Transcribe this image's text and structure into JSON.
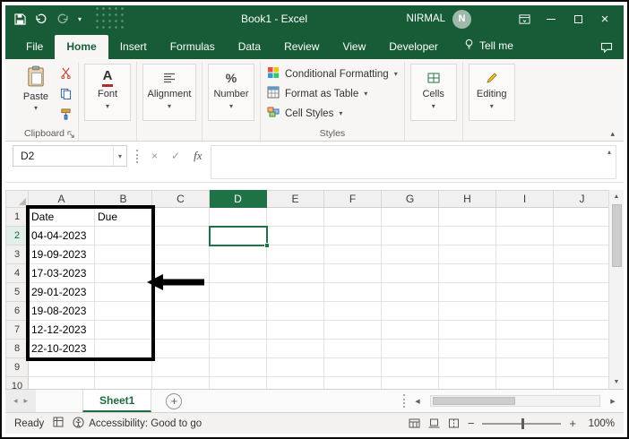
{
  "glyphs": {
    "chevron_down": "▾",
    "chevron_up": "▴",
    "close": "×",
    "cancel": "×",
    "check": "✓",
    "scroll_up": "▲",
    "scroll_down": "▼",
    "scroll_left": "◀",
    "scroll_right": "▶",
    "nav_left": "◂",
    "nav_right": "▸",
    "plus": "+",
    "minus": "−",
    "percent": "%",
    "font_a": "A",
    "add_sheet": "+"
  },
  "titlebar": {
    "title": "Book1 - Excel",
    "user_name": "NIRMAL",
    "user_initial": "N"
  },
  "tabs": {
    "items": [
      {
        "label": "File",
        "active": false
      },
      {
        "label": "Home",
        "active": true
      },
      {
        "label": "Insert",
        "active": false
      },
      {
        "label": "Formulas",
        "active": false
      },
      {
        "label": "Data",
        "active": false
      },
      {
        "label": "Review",
        "active": false
      },
      {
        "label": "View",
        "active": false
      },
      {
        "label": "Developer",
        "active": false
      }
    ],
    "tell_me": "Tell me"
  },
  "ribbon": {
    "paste": "Paste",
    "clipboard": "Clipboard",
    "font": "Font",
    "alignment": "Alignment",
    "number": "Number",
    "conditional_formatting": "Conditional Formatting",
    "format_as_table": "Format as Table",
    "cell_styles": "Cell Styles",
    "styles": "Styles",
    "cells": "Cells",
    "editing": "Editing"
  },
  "formula_bar": {
    "name_box": "D2",
    "fx": "fx",
    "value": ""
  },
  "grid": {
    "columns": [
      "A",
      "B",
      "C",
      "D",
      "E",
      "F",
      "G",
      "H",
      "I",
      "J"
    ],
    "row_count": 10,
    "selected_cell": "D2",
    "selected_column": "D",
    "selected_row": 2,
    "cells": {
      "A": [
        "Date",
        "04-04-2023",
        "19-09-2023",
        "17-03-2023",
        "29-01-2023",
        "19-08-2023",
        "12-12-2023",
        "22-10-2023"
      ],
      "B": [
        "Due",
        "",
        "",
        "",
        "",
        "",
        "",
        ""
      ]
    }
  },
  "sheetbar": {
    "sheet_name": "Sheet1"
  },
  "statusbar": {
    "mode": "Ready",
    "accessibility": "Accessibility: Good to go",
    "zoom_level": "100%"
  }
}
